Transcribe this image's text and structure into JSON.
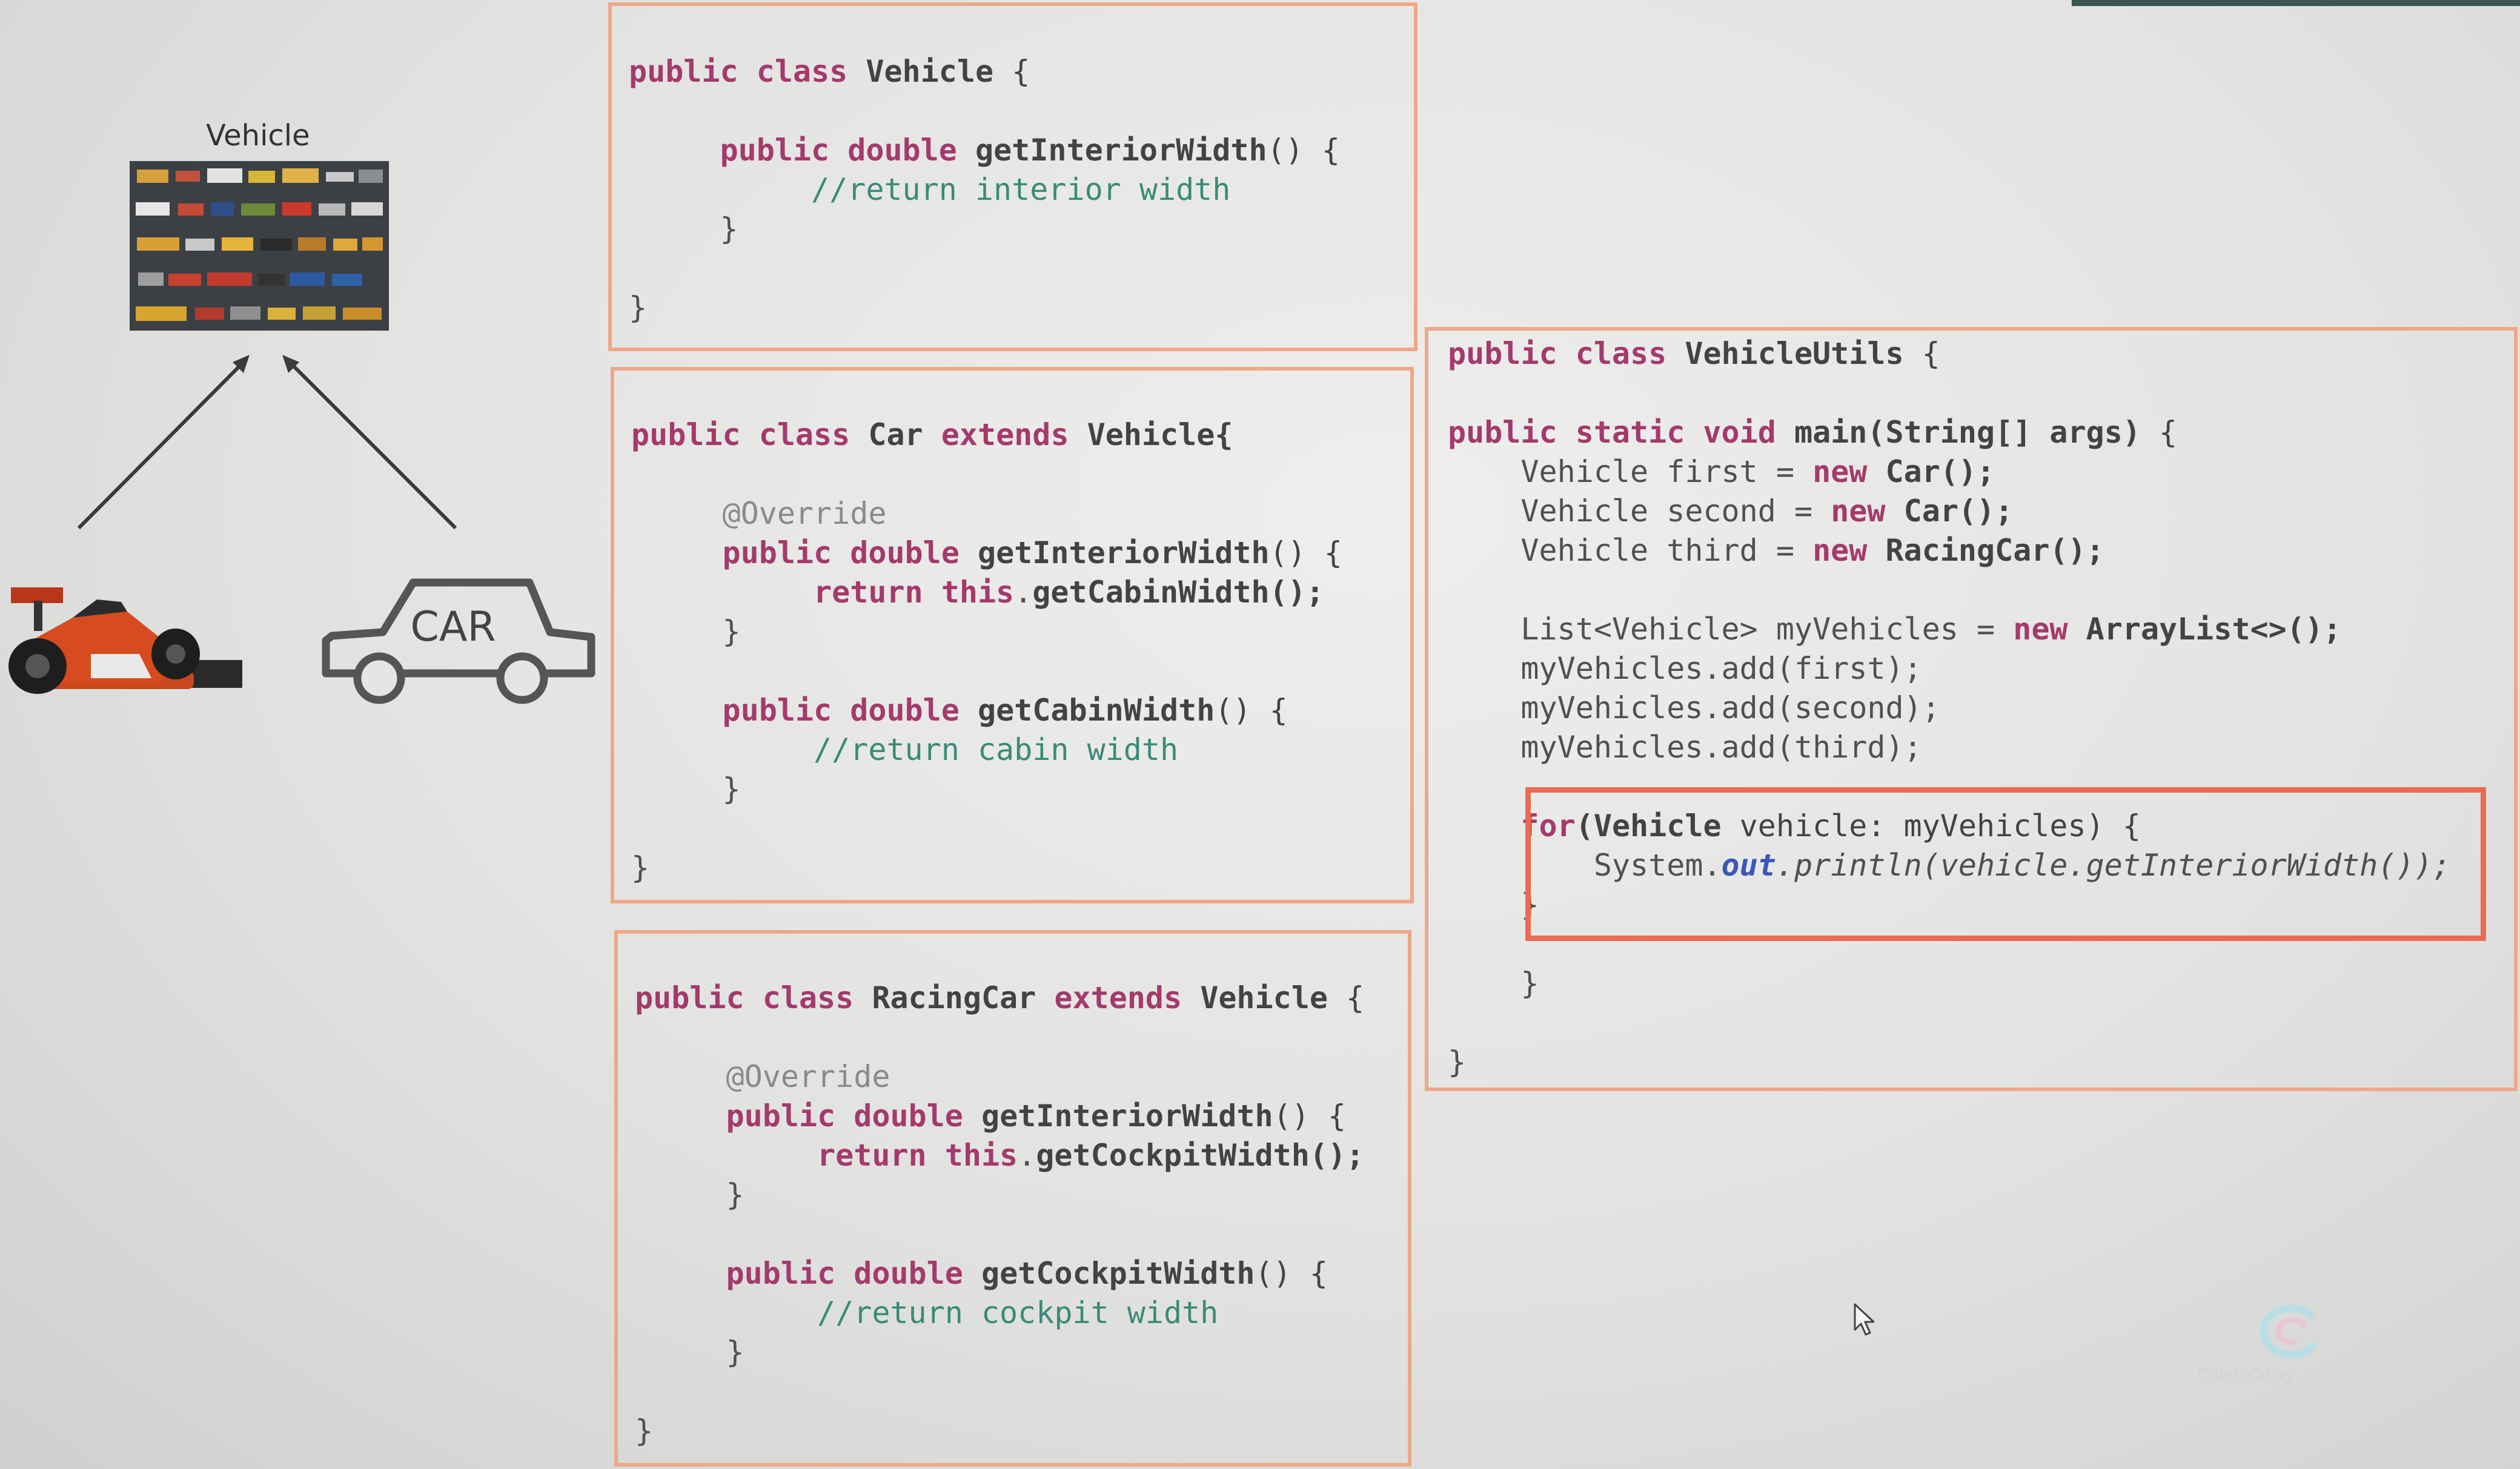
{
  "diagram": {
    "title": "Vehicle",
    "car_label": "CAR",
    "watermark": "Caleb Curry"
  },
  "icons": {
    "vehicle_collage": "vehicle-collage-image",
    "race_car": "formula-race-car-image",
    "car": "car-outline-icon",
    "cursor": "mouse-cursor-icon",
    "logo": "brand-logo-icon"
  },
  "colors": {
    "keyword": "#a43a6c",
    "comment": "#3b8a78",
    "box_border": "#eea889",
    "highlight_border": "#ea6b52",
    "static_field": "#3a56b8"
  },
  "vehicle_class": {
    "l1_kw": "public class",
    "l1_name": "Vehicle",
    "l1_brace": " {",
    "l2_kw": "public double",
    "l2_method": "getInteriorWidth",
    "l2_rest": "() {",
    "l3_comment": "//return interior width",
    "l4_close": "}",
    "l5_close": "}"
  },
  "car_class": {
    "l1_kw1": "public class",
    "l1_name": "Car",
    "l1_kw2": "extends",
    "l1_super": "Vehicle",
    "l1_brace": "{",
    "l2_annotation": "@Override",
    "l3_kw": "public double",
    "l3_method": "getInteriorWidth",
    "l3_rest": "() {",
    "l4_kw": "return this",
    "l4_call": "getCabinWidth",
    "l4_rest": "();",
    "l5_close": "}",
    "l6_kw": "public double",
    "l6_method": "getCabinWidth",
    "l6_rest": "() {",
    "l7_comment": "//return cabin width",
    "l8_close": "}",
    "l9_close": "}"
  },
  "racingcar_class": {
    "l1_kw1": "public class",
    "l1_name": "RacingCar",
    "l1_kw2": "extends",
    "l1_super": "Vehicle",
    "l1_brace": " {",
    "l2_annotation": "@Override",
    "l3_kw": "public double",
    "l3_method": "getInteriorWidth",
    "l3_rest": "() {",
    "l4_kw": "return this",
    "l4_call": "getCockpitWidth",
    "l4_rest": "();",
    "l5_close": "}",
    "l6_kw": "public double",
    "l6_method": "getCockpitWidth",
    "l6_rest": "() {",
    "l7_comment": "//return cockpit width",
    "l8_close": "}",
    "l9_close": "}"
  },
  "utils_class": {
    "l1_kw": "public class",
    "l1_name": "VehicleUtils",
    "l1_brace": " {",
    "l2_kw": "public static void",
    "l2_method": "main(String[] args)",
    "l2_rest": " {",
    "l3_type": "Vehicle",
    "l3_var": "first",
    "l3_eq": " = ",
    "l3_new": "new",
    "l3_ctor": "Car",
    "l3_rest": "();",
    "l4_type": "Vehicle",
    "l4_var": "second",
    "l4_eq": " = ",
    "l4_new": "new",
    "l4_ctor": "Car",
    "l4_rest": "();",
    "l5_type": "Vehicle",
    "l5_var": "third",
    "l5_eq": " = ",
    "l5_new": "new",
    "l5_ctor": "RacingCar",
    "l5_rest": "();",
    "l6_type": "List<Vehicle>",
    "l6_var": "myVehicles",
    "l6_eq": " = ",
    "l6_new": "new",
    "l6_ctor": "ArrayList<>",
    "l6_rest": "();",
    "l7": "myVehicles.add(first);",
    "l8": "myVehicles.add(second);",
    "l9": "myVehicles.add(third);",
    "l10_kw": "for",
    "l10_open": "(",
    "l10_type": "Vehicle",
    "l10_rest": " vehicle: myVehicles) {",
    "l11_sys": "System.",
    "l11_out": "out",
    "l11_call": ".println(vehicle.getInteriorWidth());",
    "l12_close": "}",
    "l13_close": "}",
    "l14_close": "}"
  }
}
